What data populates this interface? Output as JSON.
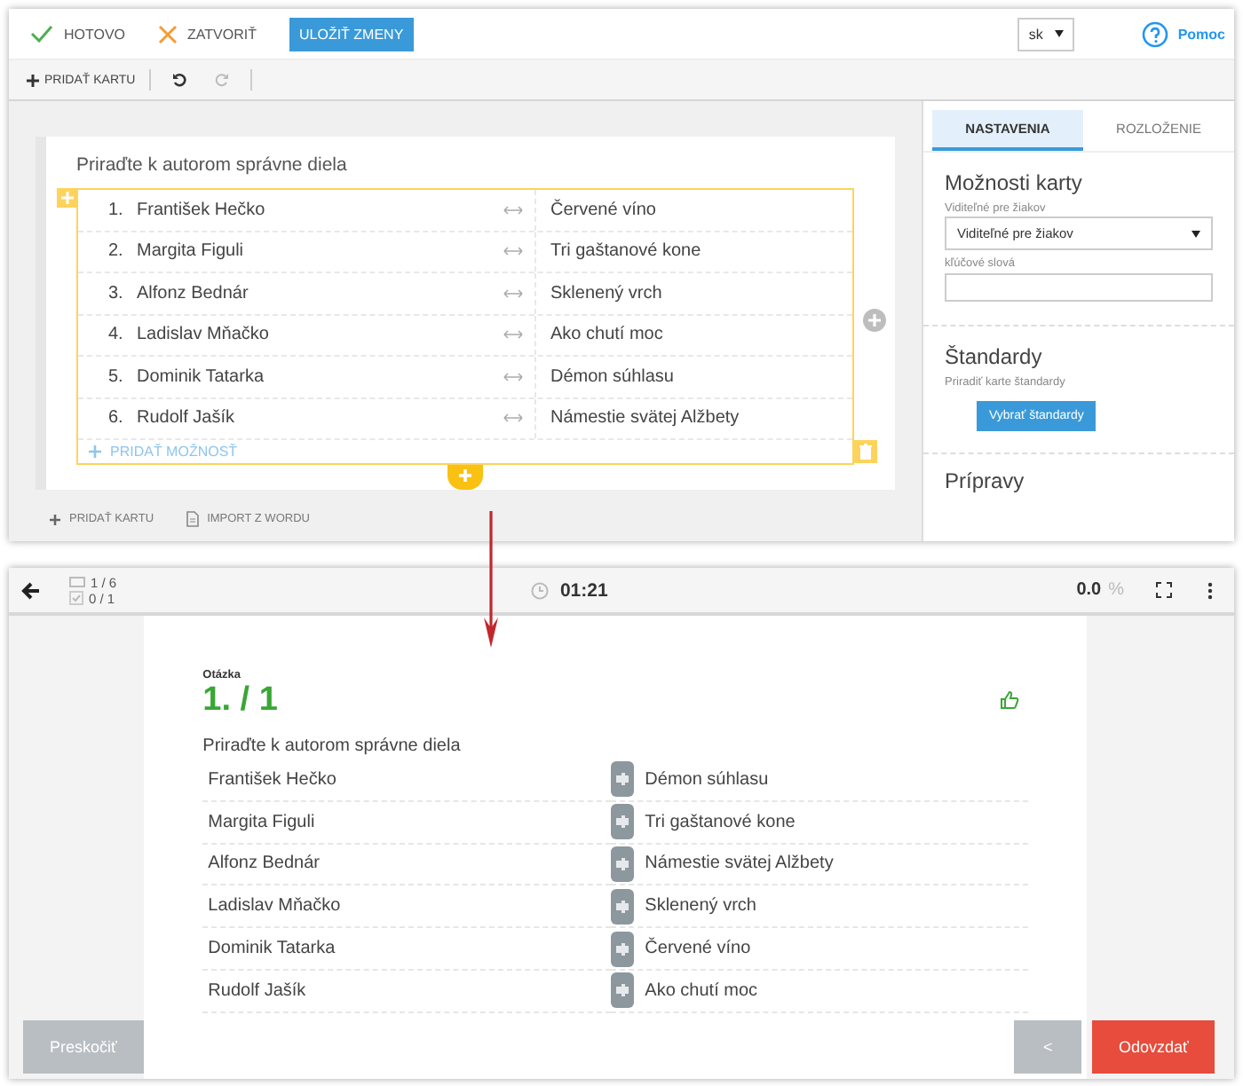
{
  "editor": {
    "header": {
      "done": "HOTOVO",
      "close": "ZATVORIŤ",
      "save": "ULOŽIŤ ZMENY",
      "language": "sk",
      "help": "Pomoc"
    },
    "toolbar": {
      "add_card": "PRIDAŤ KARTU"
    },
    "card": {
      "question": "Priraďte k autorom správne diela",
      "pairs": [
        {
          "number": "1.",
          "left": "František Hečko",
          "right": "Červené víno"
        },
        {
          "number": "2.",
          "left": "Margita Figuli",
          "right": "Tri gaštanové kone"
        },
        {
          "number": "3.",
          "left": "Alfonz Bednár",
          "right": "Sklenený  vrch"
        },
        {
          "number": "4.",
          "left": "Ladislav Mňačko",
          "right": "Ako chutí moc"
        },
        {
          "number": "5.",
          "left": "Dominik Tatarka",
          "right": "Démon súhlasu"
        },
        {
          "number": "6.",
          "left": "Rudolf Jašík",
          "right": "Námestie svätej Alžbety"
        }
      ],
      "add_option": "PRIDAŤ MOŽNOSŤ"
    },
    "footer": {
      "add_card": "PRIDAŤ KARTU",
      "import": "IMPORT Z WORDU"
    },
    "sidebar": {
      "tabs": [
        {
          "label": "NASTAVENIA",
          "selected": true
        },
        {
          "label": "ROZLOŽENIE",
          "selected": false
        }
      ],
      "card_options": {
        "title": "Možnosti karty",
        "visibility_label": "Viditeľné pre žiakov",
        "visibility_value": "Viditeľné pre žiakov",
        "keywords_label": "kľúčové slová"
      },
      "standards": {
        "title": "Štandardy",
        "hint": "Priradiť karte štandardy",
        "button": "Vybrať štandardy"
      },
      "preparations": {
        "title": "Prípravy"
      }
    }
  },
  "player": {
    "toolbar": {
      "cards": "1 / 6",
      "answered": "0 / 1",
      "timer": "01:21",
      "score": "0.0",
      "score_unit": "%"
    },
    "question_label": "Otázka",
    "question_number": "1. / 1",
    "question": "Priraďte k autorom správne diela",
    "left_items": [
      "František Hečko",
      "Margita Figuli",
      "Alfonz Bednár",
      "Ladislav Mňačko",
      "Dominik Tatarka",
      "Rudolf Jašík"
    ],
    "right_items": [
      "Démon súhlasu",
      "Tri gaštanové kone",
      "Námestie svätej Alžbety",
      "Sklenený  vrch",
      "Červené víno",
      "Ako chutí moc"
    ],
    "skip": "Preskočiť",
    "previous": "<",
    "submit": "Odovzdať"
  }
}
